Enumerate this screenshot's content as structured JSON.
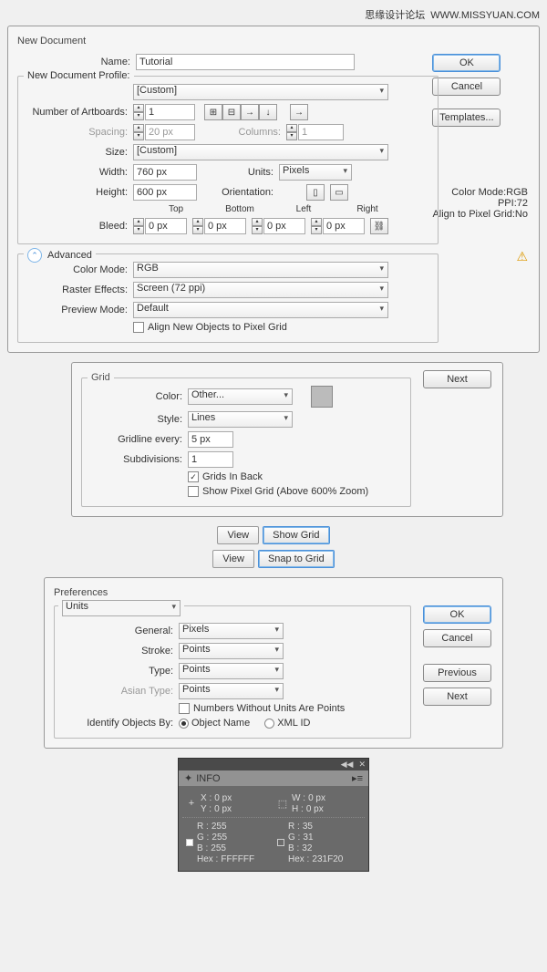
{
  "watermark": {
    "cn": "思缘设计论坛",
    "url": "WWW.MISSYUAN.COM"
  },
  "dlg1": {
    "title": "New Document",
    "name_lbl": "Name:",
    "name": "Tutorial",
    "profile_lbl": "New Document Profile:",
    "profile": "[Custom]",
    "artboards_lbl": "Number of Artboards:",
    "artboards": "1",
    "spacing_lbl": "Spacing:",
    "spacing": "20 px",
    "columns_lbl": "Columns:",
    "columns": "1",
    "size_lbl": "Size:",
    "size": "[Custom]",
    "width_lbl": "Width:",
    "width": "760 px",
    "units_lbl": "Units:",
    "units": "Pixels",
    "height_lbl": "Height:",
    "height": "600 px",
    "orient_lbl": "Orientation:",
    "bleed_lbl": "Bleed:",
    "bleed_top_lbl": "Top",
    "bleed_bottom_lbl": "Bottom",
    "bleed_left_lbl": "Left",
    "bleed_right_lbl": "Right",
    "bleed_top": "0 px",
    "bleed_bottom": "0 px",
    "bleed_left": "0 px",
    "bleed_right": "0 px",
    "advanced": "Advanced",
    "colormode_lbl": "Color Mode:",
    "colormode": "RGB",
    "raster_lbl": "Raster Effects:",
    "raster": "Screen (72 ppi)",
    "preview_lbl": "Preview Mode:",
    "preview": "Default",
    "align_check": "Align New Objects to Pixel Grid",
    "ok": "OK",
    "cancel": "Cancel",
    "templates": "Templates...",
    "meta1": "Color Mode:RGB",
    "meta2": "PPI:72",
    "meta3": "Align to Pixel Grid:No"
  },
  "dlg2": {
    "grid": "Grid",
    "color_lbl": "Color:",
    "color": "Other...",
    "style_lbl": "Style:",
    "style": "Lines",
    "gridline_lbl": "Gridline every:",
    "gridline": "5 px",
    "subdiv_lbl": "Subdivisions:",
    "subdiv": "1",
    "gridsback": "Grids In Back",
    "showpixel": "Show Pixel Grid (Above 600% Zoom)",
    "next": "Next"
  },
  "menu1": {
    "view": "View",
    "showgrid": "Show Grid"
  },
  "menu2": {
    "view": "View",
    "snap": "Snap to Grid"
  },
  "dlg3": {
    "title": "Preferences",
    "units": "Units",
    "general_lbl": "General:",
    "general": "Pixels",
    "stroke_lbl": "Stroke:",
    "stroke": "Points",
    "type_lbl": "Type:",
    "type": "Points",
    "asian_lbl": "Asian Type:",
    "asian": "Points",
    "nounits": "Numbers Without Units Are Points",
    "identify_lbl": "Identify Objects By:",
    "objname": "Object Name",
    "xmlid": "XML ID",
    "ok": "OK",
    "cancel": "Cancel",
    "prev": "Previous",
    "next": "Next"
  },
  "info": {
    "title": "INFO",
    "x": "X :",
    "xv": "0 px",
    "y": "Y :",
    "yv": "0 px",
    "w": "W :",
    "wv": "0 px",
    "h": "H :",
    "hv": "0 px",
    "r1": "R :",
    "r1v": "255",
    "g1": "G :",
    "g1v": "255",
    "b1": "B :",
    "b1v": "255",
    "hex1": "Hex :",
    "hex1v": "FFFFFF",
    "r2": "R :",
    "r2v": "35",
    "g2": "G :",
    "g2v": "31",
    "b2": "B :",
    "b2v": "32",
    "hex2": "Hex :",
    "hex2v": "231F20"
  }
}
